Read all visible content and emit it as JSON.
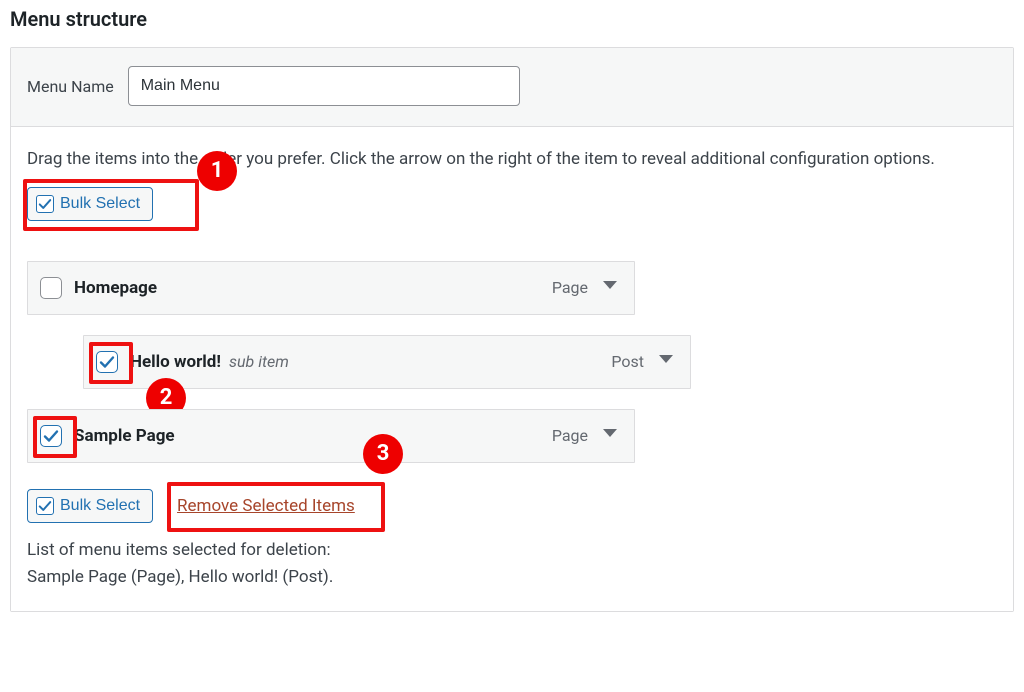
{
  "section": {
    "title": "Menu structure"
  },
  "form": {
    "menu_name_label": "Menu Name",
    "menu_name_value": "Main Menu"
  },
  "body": {
    "instructions": "Drag the items into the order you prefer. Click the arrow on the right of the item to reveal additional configuration options.",
    "bulk_select_label": "Bulk Select",
    "remove_selected_label": "Remove Selected Items",
    "deletion_heading": "List of menu items selected for deletion:",
    "deletion_items": "Sample Page (Page), Hello world! (Post)."
  },
  "menu_items": [
    {
      "title": "Homepage",
      "type": "Page",
      "checked": false,
      "depth": 0,
      "sub_label": ""
    },
    {
      "title": "Hello world!",
      "type": "Post",
      "checked": true,
      "depth": 1,
      "sub_label": "sub item"
    },
    {
      "title": "Sample Page",
      "type": "Page",
      "checked": true,
      "depth": 0,
      "sub_label": ""
    }
  ],
  "annotations": {
    "n1": "1",
    "n2": "2",
    "n3": "3"
  }
}
